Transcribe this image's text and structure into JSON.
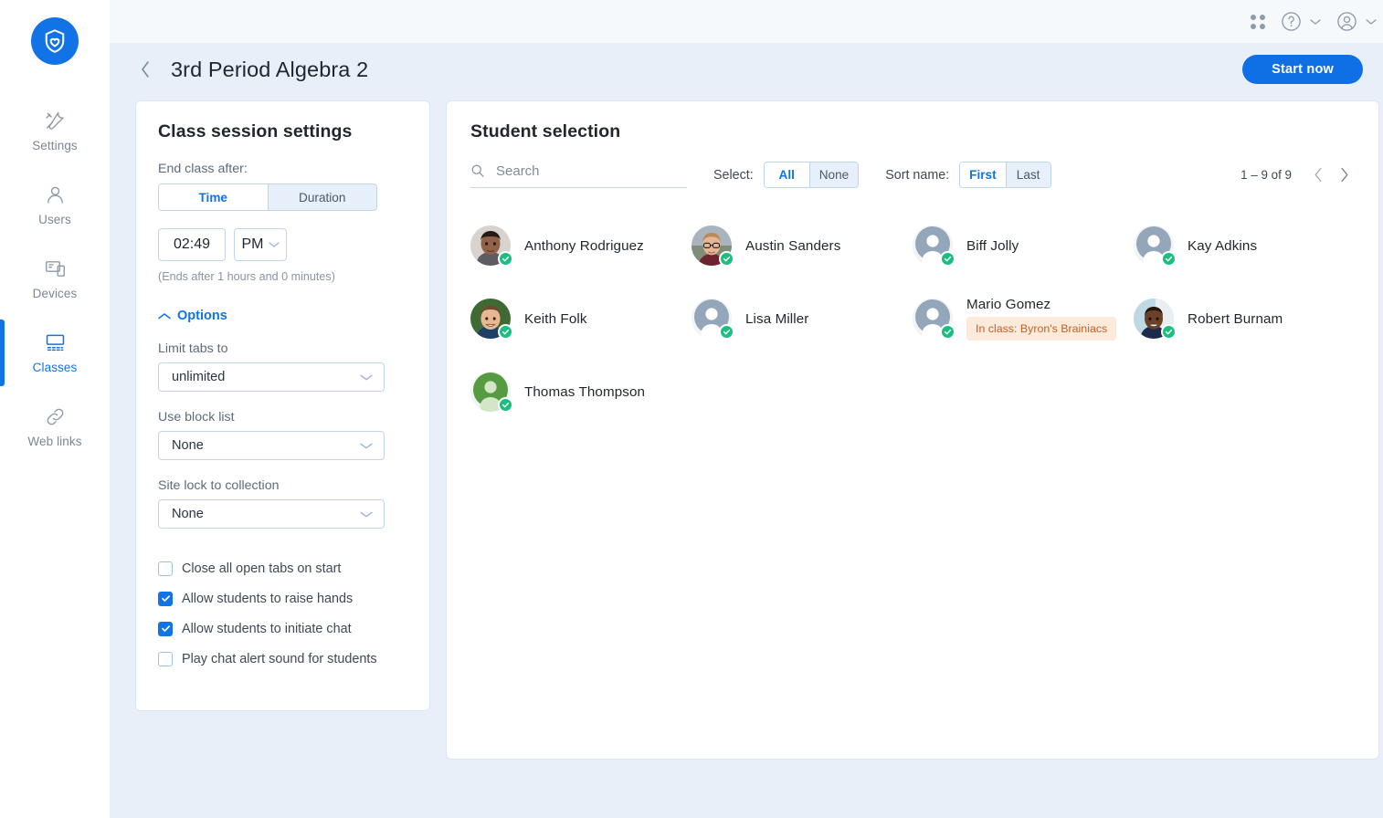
{
  "brand": {
    "logo_icon": "shield-heart-logo",
    "accent": "#1273E6",
    "success": "#17C081",
    "warning_bg": "#FCEADA",
    "warning_text": "#C0622A"
  },
  "sidebar": {
    "items": [
      {
        "label": "Settings",
        "icon": "wrench-screwdriver-icon",
        "active": false
      },
      {
        "label": "Users",
        "icon": "person-icon",
        "active": false
      },
      {
        "label": "Devices",
        "icon": "devices-icon",
        "active": false
      },
      {
        "label": "Classes",
        "icon": "classroom-icon",
        "active": true
      },
      {
        "label": "Web links",
        "icon": "link-icon",
        "active": false
      }
    ]
  },
  "topbar": {
    "apps_icon": "grid-apps-icon",
    "help_icon": "help-circle-icon",
    "help_chevron": "chevron-down-icon",
    "account_icon": "account-avatar-icon",
    "account_chevron": "chevron-down-icon"
  },
  "header": {
    "back_icon": "chevron-left-icon",
    "title": "3rd Period Algebra 2",
    "start_label": "Start now"
  },
  "settings": {
    "title": "Class session settings",
    "end_class_label": "End class after:",
    "end_mode": {
      "options": [
        "Time",
        "Duration"
      ],
      "selected": "Time"
    },
    "time_value": "02:49",
    "ampm_value": "PM",
    "ends_note": "(Ends after 1 hours and 0 minutes)",
    "options_label": "Options",
    "options_chevron": "chevron-up-icon",
    "limit_tabs_label": "Limit tabs to",
    "limit_tabs_value": "unlimited",
    "block_list_label": "Use block list",
    "block_list_value": "None",
    "site_lock_label": "Site lock to collection",
    "site_lock_value": "None",
    "checkboxes": [
      {
        "label": "Close all open tabs on start",
        "checked": false
      },
      {
        "label": "Allow students to raise hands",
        "checked": true
      },
      {
        "label": "Allow students to initiate chat",
        "checked": true
      },
      {
        "label": "Play chat alert sound for students",
        "checked": false
      }
    ]
  },
  "students_panel": {
    "title": "Student selection",
    "search_placeholder": "Search",
    "search_value": "",
    "search_icon": "search-icon",
    "select_label": "Select:",
    "select_options": [
      "All",
      "None"
    ],
    "select_selected": "All",
    "sort_label": "Sort name:",
    "sort_options": [
      "First",
      "Last"
    ],
    "sort_selected": "First",
    "pager_count": "1 – 9 of 9",
    "prev_icon": "chevron-left-icon",
    "next_icon": "chevron-right-icon",
    "students": [
      {
        "name": "Anthony Rodriguez",
        "selected": true,
        "avatar": "photo",
        "avatar_kind": "photo-anthony",
        "note": ""
      },
      {
        "name": "Austin Sanders",
        "selected": true,
        "avatar": "photo",
        "avatar_kind": "photo-austin",
        "note": ""
      },
      {
        "name": "Biff Jolly",
        "selected": true,
        "avatar": "placeholder-gray",
        "avatar_kind": "placeholder",
        "note": ""
      },
      {
        "name": "Kay Adkins",
        "selected": true,
        "avatar": "placeholder-gray",
        "avatar_kind": "placeholder",
        "note": ""
      },
      {
        "name": "Keith Folk",
        "selected": true,
        "avatar": "photo",
        "avatar_kind": "photo-keith",
        "note": ""
      },
      {
        "name": "Lisa Miller",
        "selected": true,
        "avatar": "placeholder-gray",
        "avatar_kind": "placeholder",
        "note": ""
      },
      {
        "name": "Mario Gomez",
        "selected": true,
        "avatar": "placeholder-gray",
        "avatar_kind": "placeholder",
        "note": "In class: Byron's Brainiacs"
      },
      {
        "name": "Robert Burnam",
        "selected": true,
        "avatar": "photo",
        "avatar_kind": "photo-robert",
        "note": ""
      },
      {
        "name": "Thomas Thompson",
        "selected": true,
        "avatar": "placeholder-green",
        "avatar_kind": "placeholder",
        "note": ""
      }
    ]
  }
}
